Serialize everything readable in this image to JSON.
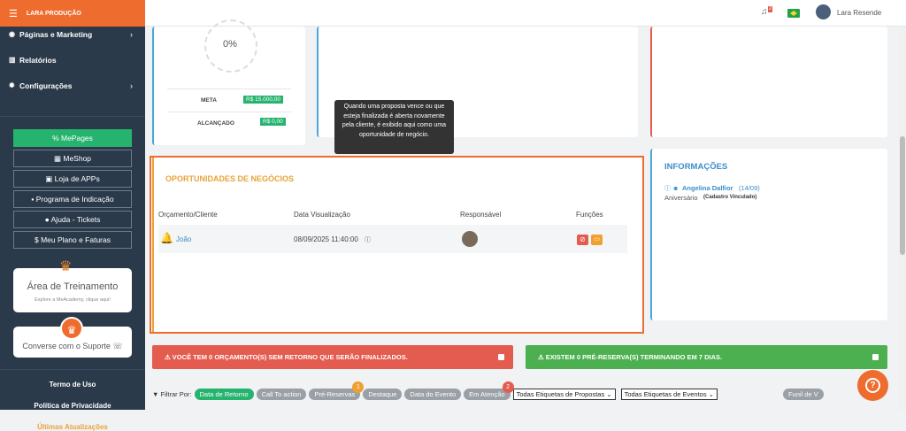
{
  "brand": "LARA PRODUÇÃO",
  "sidebar": {
    "items": [
      {
        "icon": "◉",
        "label": "Páginas e Marketing",
        "chev": "›"
      },
      {
        "icon": "▥",
        "label": "Relatórios",
        "chev": ""
      },
      {
        "icon": "✹",
        "label": "Configurações",
        "chev": "›"
      }
    ],
    "buttons": [
      "% MePages",
      "▦ MeShop",
      "▣ Loja de APPs",
      "▪ Programa de Indicação",
      "● Ajuda - Tickets",
      "$ Meu Plano e Faturas"
    ],
    "training_title": "Área de Treinamento",
    "training_sub": "Explore a MeAcademy, clique aqui!",
    "support": "Converse com o Suporte ☏",
    "footer": [
      "Termo de Uso",
      "Política de Privacidade",
      "Últimas Atualizações"
    ]
  },
  "topbar": {
    "user": "Lara Resende",
    "notif_count": "2"
  },
  "goal": {
    "percent": "0%",
    "meta_label": "META",
    "meta_value": "R$ 15.000,00",
    "achieved_label": "ALCANÇADO",
    "achieved_value": "R$ 0,00"
  },
  "tooltip": "Quando uma proposta vence ou que esteja finalizada é aberta novamente pela cliente, é exibido aqui como uma oportunidade de negócio.",
  "opportunities": {
    "title": "OPORTUNIDADES DE NEGÓCIOS",
    "columns": [
      "Orçamento/Cliente",
      "Data Visualização",
      "Responsável",
      "Funções"
    ],
    "row": {
      "client": "João",
      "date": "08/09/2025 11:40:00"
    }
  },
  "info": {
    "title": "INFORMAÇÕES",
    "person": "Angelina Dalfior",
    "person_date": "(14/09)",
    "line2": "Aniversário",
    "line2_tag": "(Cadastro Vinculado)"
  },
  "alerts": {
    "red": "⚠ VOCÊ TEM 0 ORÇAMENTO(S) SEM RETORNO QUE SERÃO FINALIZADOS.",
    "green": "⚠ EXISTEM 0 PRÉ-RESERVA(S) TERMINANDO EM 7 DIAS."
  },
  "filter": {
    "label": "▼ Filtrar Por:",
    "tags": [
      "Data de Retorno",
      "Call To action",
      "Pré-Reservas",
      "Destaque",
      "Data do Evento",
      "Em Atenção"
    ],
    "badge_pre": "1",
    "badge_atencao": "2",
    "select1": "Todas Etiquetas de Propostas ⌄",
    "select2": "Todas Etiquetas de Eventos ⌄",
    "funil": "Funil de V"
  },
  "colors": {
    "accent": "#ef6c2f",
    "sidebar": "#2b3a4a",
    "green": "#26b36e",
    "red": "#e45b4f",
    "info": "#3a8fc9"
  }
}
